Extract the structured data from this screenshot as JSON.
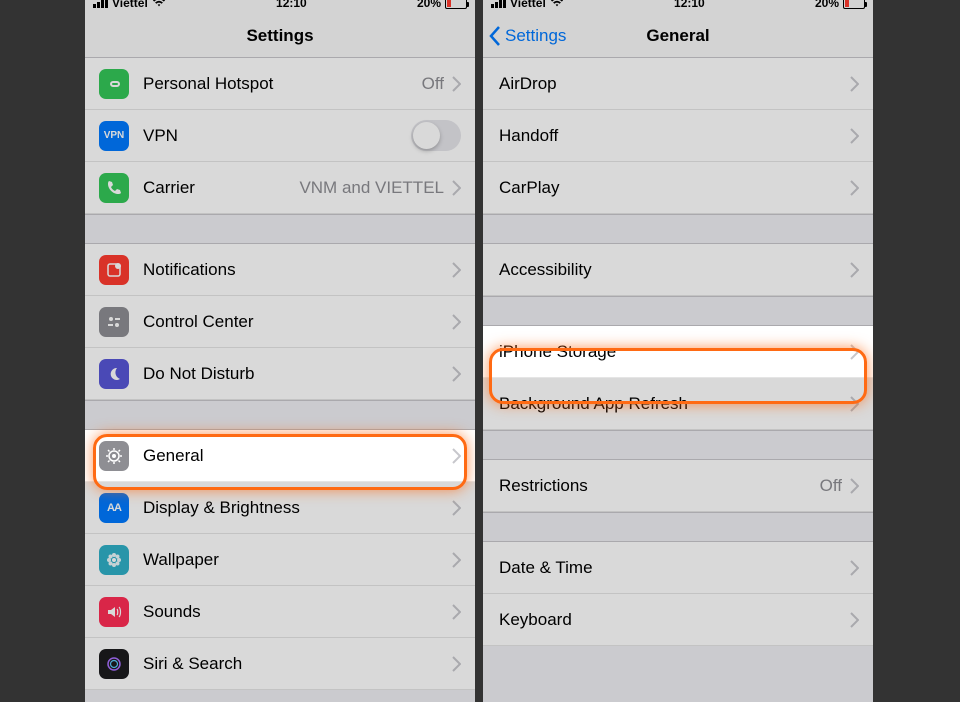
{
  "status": {
    "carrier": "Viettel",
    "time": "12:10",
    "battery_pct": "20%"
  },
  "left": {
    "title": "Settings",
    "rows": {
      "hotspot": {
        "label": "Personal Hotspot",
        "value": "Off"
      },
      "vpn": {
        "label": "VPN"
      },
      "carrier": {
        "label": "Carrier",
        "value": "VNM and VIETTEL"
      },
      "notifications": {
        "label": "Notifications"
      },
      "control_center": {
        "label": "Control Center"
      },
      "dnd": {
        "label": "Do Not Disturb"
      },
      "general": {
        "label": "General"
      },
      "display": {
        "label": "Display & Brightness"
      },
      "wallpaper": {
        "label": "Wallpaper"
      },
      "sounds": {
        "label": "Sounds"
      },
      "siri": {
        "label": "Siri & Search"
      }
    }
  },
  "right": {
    "back": "Settings",
    "title": "General",
    "rows": {
      "airdrop": {
        "label": "AirDrop"
      },
      "handoff": {
        "label": "Handoff"
      },
      "carplay": {
        "label": "CarPlay"
      },
      "accessibility": {
        "label": "Accessibility"
      },
      "iphone_storage": {
        "label": "iPhone Storage"
      },
      "bg_refresh": {
        "label": "Background App Refresh"
      },
      "restrictions": {
        "label": "Restrictions",
        "value": "Off"
      },
      "date_time": {
        "label": "Date & Time"
      },
      "keyboard": {
        "label": "Keyboard"
      }
    }
  }
}
